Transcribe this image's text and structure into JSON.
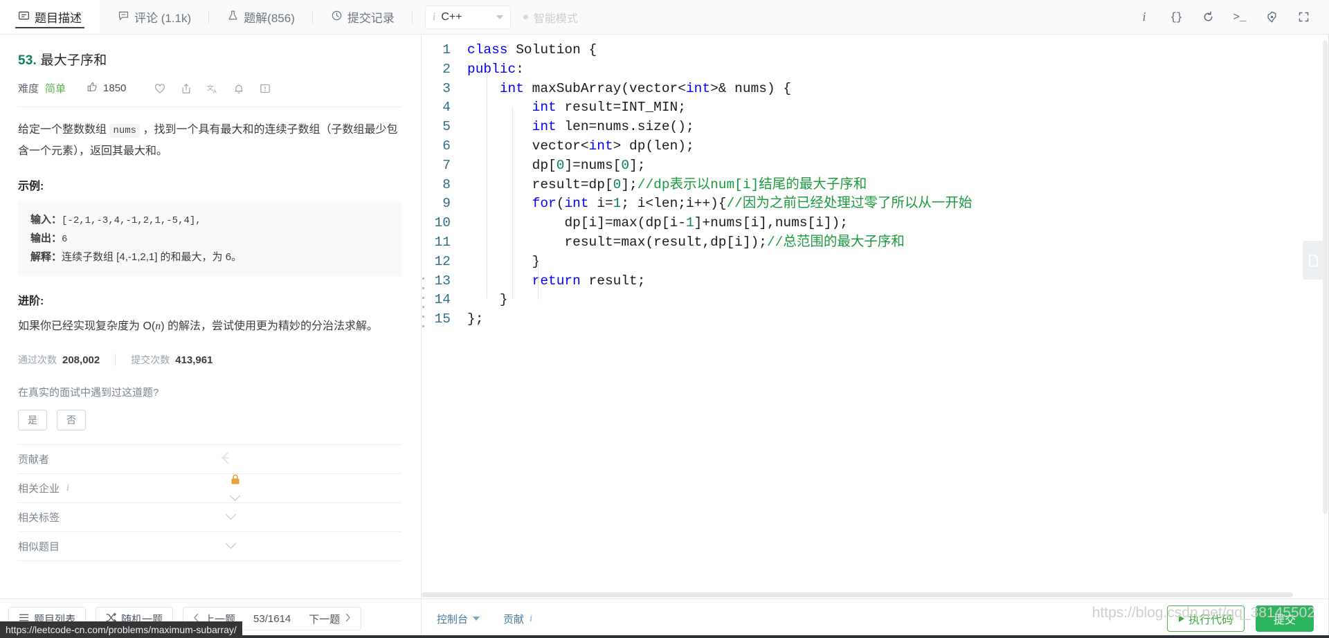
{
  "topbar": {
    "tabs": [
      {
        "label": "题目描述",
        "icon": "description-icon",
        "active": true
      },
      {
        "label": "评论 (1.1k)",
        "icon": "comment-icon",
        "active": false
      },
      {
        "label": "题解(856)",
        "icon": "flask-icon",
        "active": false
      },
      {
        "label": "提交记录",
        "icon": "clock-icon",
        "active": false
      }
    ],
    "language": {
      "value": "C++",
      "info": "i"
    },
    "smart_mode": "智能模式",
    "icons": [
      "info-icon",
      "format-braces-icon",
      "reset-icon",
      "console-icon",
      "settings-icon",
      "fullscreen-icon"
    ]
  },
  "problem": {
    "number": "53.",
    "title": "最大子序和",
    "difficulty_label": "难度",
    "difficulty_value": "简单",
    "likes": "1850",
    "action_icons": [
      "thumbs-up-icon",
      "heart-icon",
      "share-icon",
      "translate-icon",
      "bell-icon",
      "feedback-icon"
    ],
    "description_pre": "给定一个整数数组 ",
    "description_code": "nums",
    "description_post": " ，找到一个具有最大和的连续子数组（子数组最少包含一个元素），返回其最大和。",
    "example_heading": "示例:",
    "example": {
      "input_label": "输入：",
      "input_value": "[-2,1,-3,4,-1,2,1,-5,4],",
      "output_label": "输出：",
      "output_value": "6",
      "explain_label": "解释：",
      "explain_value": "连续子数组 [4,-1,2,1] 的和最大，为 6。"
    },
    "advanced_heading": "进阶:",
    "advanced_pre": "如果你已经实现复杂度为 O(",
    "advanced_var": "n",
    "advanced_post": ") 的解法，尝试使用更为精妙的分治法求解。",
    "stats": {
      "accepted_label": "通过次数",
      "accepted_value": "208,002",
      "submissions_label": "提交次数",
      "submissions_value": "413,961"
    },
    "interview_question": "在真实的面试中遇到过这道题?",
    "yes_label": "是",
    "no_label": "否",
    "accordions": [
      {
        "label": "贡献者",
        "right_icon": "leetcode-logo-icon"
      },
      {
        "label": "相关企业",
        "info": "i",
        "right_icon": "lock-icon",
        "chevron": true
      },
      {
        "label": "相关标签",
        "chevron": true
      },
      {
        "label": "相似题目",
        "chevron": true
      }
    ]
  },
  "leftnav": {
    "problem_list": "题目列表",
    "problem_list_icon": "list-icon",
    "random": "随机一题",
    "random_icon": "shuffle-icon",
    "prev": "上一题",
    "counter": "53/1614",
    "next": "下一题"
  },
  "editor": {
    "lines": [
      {
        "n": "1",
        "indent": 0,
        "tokens": [
          {
            "t": "class ",
            "c": "kw"
          },
          {
            "t": "Solution {",
            "c": ""
          }
        ]
      },
      {
        "n": "2",
        "indent": 0,
        "tokens": [
          {
            "t": "public",
            "c": "kw"
          },
          {
            "t": ":",
            "c": ""
          }
        ]
      },
      {
        "n": "3",
        "indent": 1,
        "tokens": [
          {
            "t": "int ",
            "c": "kw"
          },
          {
            "t": "maxSubArray(vector<",
            "c": ""
          },
          {
            "t": "int",
            "c": "kw"
          },
          {
            "t": ">& nums) {",
            "c": ""
          }
        ]
      },
      {
        "n": "4",
        "indent": 2,
        "tokens": [
          {
            "t": "int ",
            "c": "kw"
          },
          {
            "t": "result=INT_MIN;",
            "c": ""
          }
        ]
      },
      {
        "n": "5",
        "indent": 2,
        "tokens": [
          {
            "t": "int ",
            "c": "kw"
          },
          {
            "t": "len=nums.size();",
            "c": ""
          }
        ]
      },
      {
        "n": "6",
        "indent": 2,
        "tokens": [
          {
            "t": "vector<",
            "c": ""
          },
          {
            "t": "int",
            "c": "kw"
          },
          {
            "t": "> dp(len);",
            "c": ""
          }
        ]
      },
      {
        "n": "7",
        "indent": 2,
        "tokens": [
          {
            "t": "dp[",
            "c": ""
          },
          {
            "t": "0",
            "c": "num"
          },
          {
            "t": "]=nums[",
            "c": ""
          },
          {
            "t": "0",
            "c": "num"
          },
          {
            "t": "];",
            "c": ""
          }
        ]
      },
      {
        "n": "8",
        "indent": 2,
        "tokens": [
          {
            "t": "result=dp[",
            "c": ""
          },
          {
            "t": "0",
            "c": "num"
          },
          {
            "t": "];",
            "c": ""
          },
          {
            "t": "//dp表示以num[i]结尾的最大子序和",
            "c": "cmt"
          }
        ]
      },
      {
        "n": "9",
        "indent": 2,
        "tokens": [
          {
            "t": "for",
            "c": "kw"
          },
          {
            "t": "(",
            "c": ""
          },
          {
            "t": "int ",
            "c": "kw"
          },
          {
            "t": "i=",
            "c": ""
          },
          {
            "t": "1",
            "c": "num"
          },
          {
            "t": "; i<len;i++){",
            "c": ""
          },
          {
            "t": "//因为之前已经处理过零了所以从一开始",
            "c": "cmt"
          }
        ]
      },
      {
        "n": "10",
        "indent": 3,
        "tokens": [
          {
            "t": "dp[i]=max(dp[i-",
            "c": ""
          },
          {
            "t": "1",
            "c": "num"
          },
          {
            "t": "]+nums[i],nums[i]);",
            "c": ""
          }
        ]
      },
      {
        "n": "11",
        "indent": 3,
        "tokens": [
          {
            "t": "result=max(result,dp[i]);",
            "c": ""
          },
          {
            "t": "//总范围的最大子序和",
            "c": "cmt"
          }
        ]
      },
      {
        "n": "12",
        "indent": 2,
        "tokens": [
          {
            "t": "}",
            "c": ""
          }
        ]
      },
      {
        "n": "13",
        "indent": 2,
        "tokens": [
          {
            "t": "return ",
            "c": "kw"
          },
          {
            "t": "result;",
            "c": ""
          }
        ]
      },
      {
        "n": "14",
        "indent": 1,
        "tokens": [
          {
            "t": "}",
            "c": ""
          }
        ]
      },
      {
        "n": "15",
        "indent": 0,
        "tokens": [
          {
            "t": "};",
            "c": ""
          }
        ]
      }
    ]
  },
  "bottombar": {
    "console": "控制台",
    "contribute": "贡献",
    "contribute_info": "i",
    "run": "执行代码",
    "submit": "提交"
  },
  "status_url": "https://leetcode-cn.com/problems/maximum-subarray/",
  "watermark": "https://blog.csdn.net/qq_38145502",
  "colors": {
    "easy_green": "#5cb85c",
    "submit_green": "#2db55d",
    "keyword_blue": "#0000ff",
    "comment_green": "#1a9a3c",
    "number_green": "#098658",
    "gutter_blue": "#2e6d8a",
    "lock_gold": "#e3a53a"
  }
}
